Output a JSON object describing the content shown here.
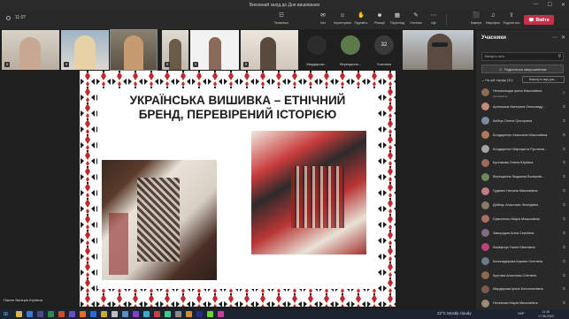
{
  "titlebar": {
    "title": "Виховний захід до Дня вишиванки",
    "min": "—",
    "max": "☐",
    "close": "✕"
  },
  "toolbar": {
    "timer": "11:07",
    "buttons": [
      {
        "label": "Пильніше",
        "icon": "☷"
      },
      {
        "label": "Чат",
        "icon": "✉"
      },
      {
        "label": "Користувачі",
        "icon": "☺"
      },
      {
        "label": "Підніміть",
        "icon": "✋"
      },
      {
        "label": "Реакції",
        "icon": "☻"
      },
      {
        "label": "Перегляд",
        "icon": "▦"
      },
      {
        "label": "Нотатки",
        "icon": "✎"
      },
      {
        "label": "Ще",
        "icon": "⋯"
      },
      {
        "label": "Камера",
        "icon": "⬛"
      },
      {
        "label": "Мікрофон",
        "icon": "♫"
      },
      {
        "label": "Поділитися",
        "icon": "⇧"
      }
    ],
    "leave_label": "Вийти"
  },
  "strip": {
    "avatars": [
      {
        "name": "Мардарохи...",
        "color": "#2c2c2c"
      },
      {
        "name": "Верещагіна...",
        "color": "#5c7a4c"
      }
    ],
    "overflow_count": "32",
    "overflow_label": "Учасники"
  },
  "slide": {
    "title_line1": "УКРАЇНСЬКА ВИШИВКА – ЕТНІЧНИЙ",
    "title_line2": "БРЕНД, ПЕРЕВІРЕНИЙ ІСТОРІЄЮ"
  },
  "presenter_name": "Пікеле Валерія Юріївна",
  "panel": {
    "title": "Учасники",
    "search_placeholder": "Введіть ім'я",
    "invite_label": "Поділитися запрошенням",
    "section_label": "На цій нараді (32)",
    "mute_all_label": "Вимкнути звук для ...",
    "participants": [
      {
        "name": "Непомнящая Ірина Миколаївна",
        "role": "Організатор",
        "color": "#8b6b55"
      },
      {
        "name": "Артюшина Катерина Олександр...",
        "color": "#c48a7a"
      },
      {
        "name": "Кабчук Олена Григорівна",
        "color": "#7a8aa0"
      },
      {
        "name": "Бондаренко Анастасія Миколаївна",
        "color": "#b07a5a"
      },
      {
        "name": "Бондаренко Маргарита Русланів...",
        "color": "#a5a5a5"
      },
      {
        "name": "Булгакова Олена Юріївна",
        "color": "#9a6a5a"
      },
      {
        "name": "Верещагіна Людмила Всеволів...",
        "color": "#6a8a5a"
      },
      {
        "name": "Гуданич Наталія Миколаївна",
        "color": "#c07f86"
      },
      {
        "name": "Дибець Анастасія Леонідівна",
        "color": "#8a7a6a"
      },
      {
        "name": "Єрмоленко Марія Миколаївна",
        "color": "#a87060"
      },
      {
        "name": "Завородня Анна Сергіївна",
        "color": "#7f6a8a"
      },
      {
        "name": "Казімірчук Ганна Євгенівна",
        "color": "#c0407a"
      },
      {
        "name": "Кононадерова Карина Олегівна",
        "color": "#6a7a8a"
      },
      {
        "name": "Крутова Анастасія Олегівна",
        "color": "#8a6a4a"
      },
      {
        "name": "Мардарова Ірина Костянтинівна",
        "color": "#7a5a4a"
      },
      {
        "name": "Несвітова Марія Миколаївна",
        "color": "#9a8a7a"
      }
    ]
  },
  "taskbar": {
    "weather": "22°C  Mostly cloudy",
    "lang": "УКР",
    "time": "11:16",
    "date": "17.05.2023"
  }
}
